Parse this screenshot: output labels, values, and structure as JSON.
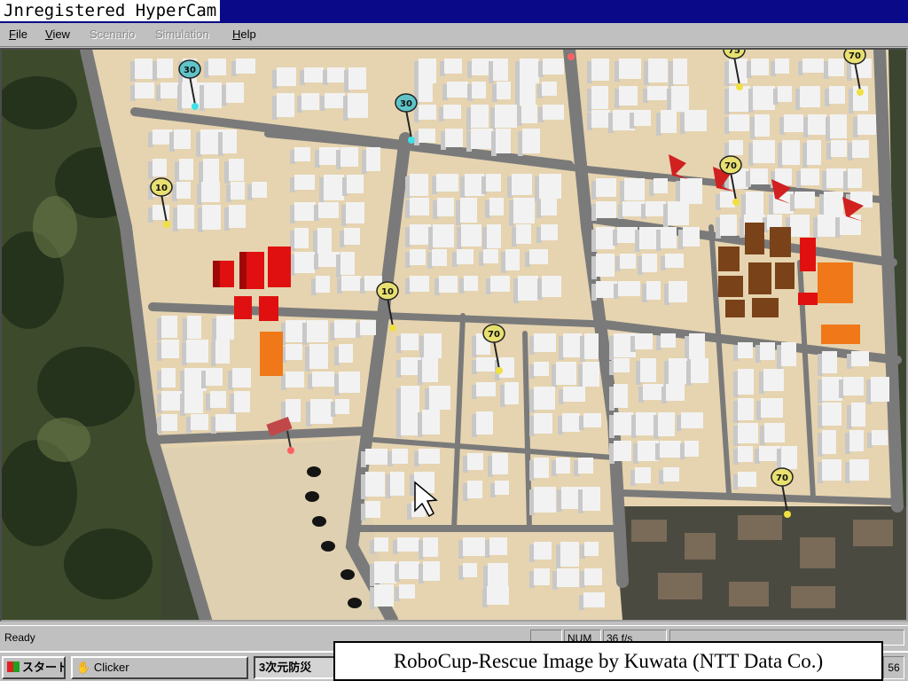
{
  "window": {
    "title": "Jnregistered HyperCam"
  },
  "menu": [
    {
      "label": "File",
      "enabled": true
    },
    {
      "label": "View",
      "enabled": true
    },
    {
      "label": "Scenario",
      "enabled": false
    },
    {
      "label": "Simulation",
      "enabled": false
    },
    {
      "label": "Help",
      "enabled": true
    }
  ],
  "map": {
    "markers": [
      {
        "label": "30",
        "color": "#5fc4c8"
      },
      {
        "label": "30",
        "color": "#5fc4c8"
      },
      {
        "label": "10",
        "color": "#e8e070"
      },
      {
        "label": "10",
        "color": "#e8e070"
      },
      {
        "label": "70",
        "color": "#e8e070"
      },
      {
        "label": "75",
        "color": "#e8e070"
      },
      {
        "label": "70",
        "color": "#e8e070"
      },
      {
        "label": "70",
        "color": "#e8e070"
      },
      {
        "label": "70",
        "color": "#e8e070"
      }
    ],
    "colors": {
      "ground": "#e6d4b0",
      "road": "#7a7a7a",
      "building": "#f2f2f2",
      "burning": "#e01010",
      "burnt": "#7a4218",
      "heating": "#f07818"
    }
  },
  "status": {
    "ready": "Ready",
    "num": "NUM",
    "fps": "36 f/s"
  },
  "taskbar": {
    "start": "スタート",
    "clicker": "Clicker",
    "app": "3次元防災",
    "clock": "56"
  },
  "caption": "RoboCup-Rescue Image by Kuwata (NTT Data Co.)"
}
